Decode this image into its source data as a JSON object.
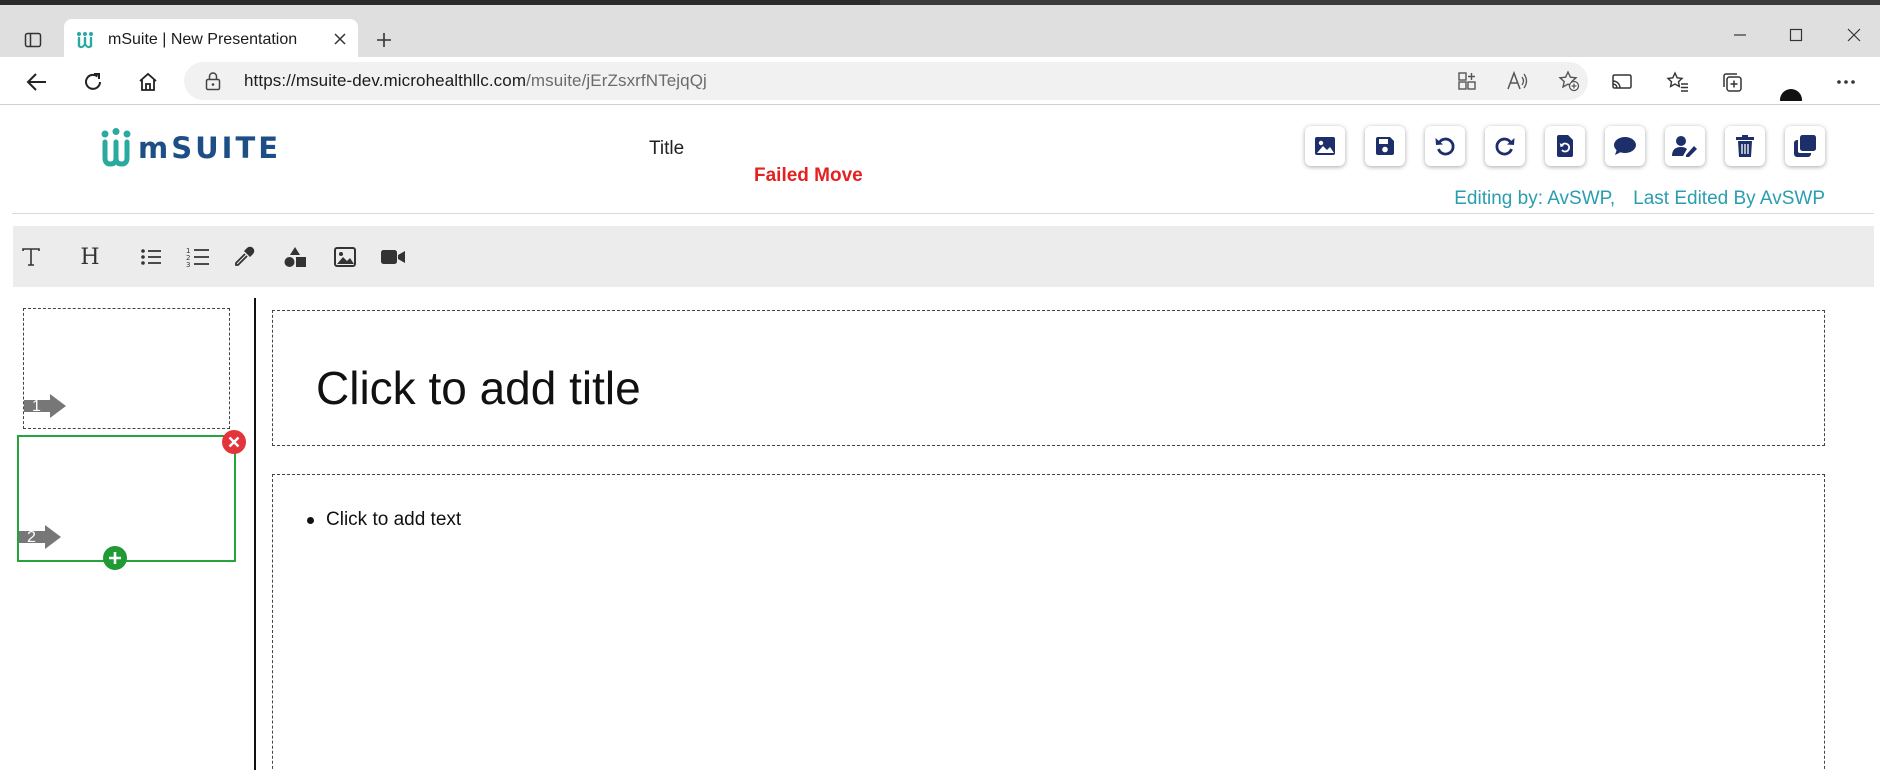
{
  "browser": {
    "tab_title": "mSuite | New Presentation",
    "url_host": "https://msuite-dev.microhealthllc.com",
    "url_path": "/msuite/jErZsxrfNTejqQj"
  },
  "app": {
    "logo_text": "mSUITE",
    "doc_title": "Title",
    "status_message": "Failed Move",
    "editing_by": "Editing by: AvSWP,",
    "last_edited_by": "Last Edited By AvSWP",
    "toolbar_icons": [
      "image-icon",
      "save-icon",
      "undo-icon",
      "redo-icon",
      "history-icon",
      "comment-icon",
      "user-edit-icon",
      "trash-icon",
      "copy-icon"
    ],
    "format_icons": [
      "text-icon",
      "heading-icon",
      "bullet-list-icon",
      "numbered-list-icon",
      "eyedropper-icon",
      "shapes-icon",
      "image-icon",
      "video-icon"
    ],
    "format_text": {
      "text_glyph": "T",
      "heading_glyph": "H"
    }
  },
  "slides": {
    "thumbnails": [
      {
        "number": "1"
      },
      {
        "number": "2"
      }
    ],
    "title_placeholder": "Click to add title",
    "body_placeholder": "Click to add text"
  },
  "colors": {
    "brand": "#1d4f86",
    "accent": "#2a9db0",
    "error": "#e32222",
    "selected": "#27a33b",
    "toolbar_icon": "#1c2f6b"
  }
}
